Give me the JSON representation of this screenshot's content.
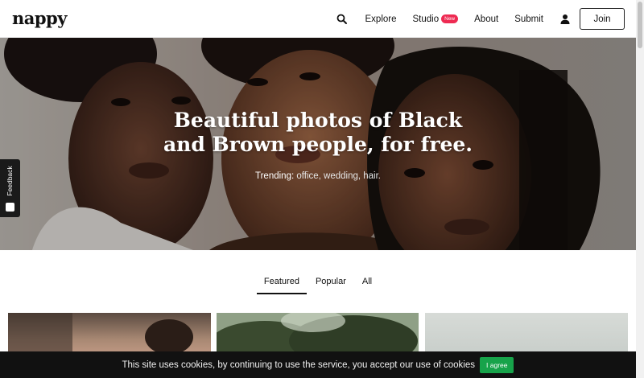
{
  "brand": {
    "logo": "nappy"
  },
  "nav": {
    "explore": "Explore",
    "studio": "Studio",
    "studio_badge": "New",
    "about": "About",
    "submit": "Submit",
    "join": "Join",
    "icons": {
      "search": "search-icon",
      "user": "user-icon"
    }
  },
  "hero": {
    "title_line1": "Beautiful photos of Black",
    "title_line2": "and Brown people, for free.",
    "trending_label": "Trending:",
    "trending_links": "office, wedding, hair."
  },
  "feedback": {
    "label": "Feedback"
  },
  "tabs": [
    {
      "label": "Featured",
      "active": true
    },
    {
      "label": "Popular",
      "active": false
    },
    {
      "label": "All",
      "active": false
    }
  ],
  "cookie": {
    "text": "This site uses cookies, by continuing to use the service, you accept our use of cookies",
    "button": "I agree"
  },
  "colors": {
    "accent_badge": "#ee2a52",
    "agree_green": "#17a34a",
    "cookie_bg": "#111111"
  }
}
